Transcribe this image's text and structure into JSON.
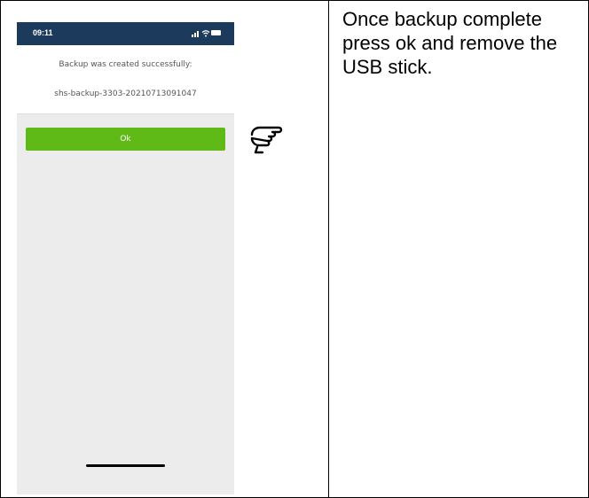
{
  "phone": {
    "status_time": "09:11",
    "message": "Backup was created successfully:",
    "filename": "shs-backup-3303-20210713091047",
    "ok_label": "Ok"
  },
  "instruction": {
    "text": "Once backup complete press ok and remove the USB stick."
  },
  "colors": {
    "status_bar": "#1c3a5c",
    "ok_button": "#5fba17",
    "panel": "#ececec"
  },
  "icons": {
    "pointer": "pointing-hand-icon"
  }
}
